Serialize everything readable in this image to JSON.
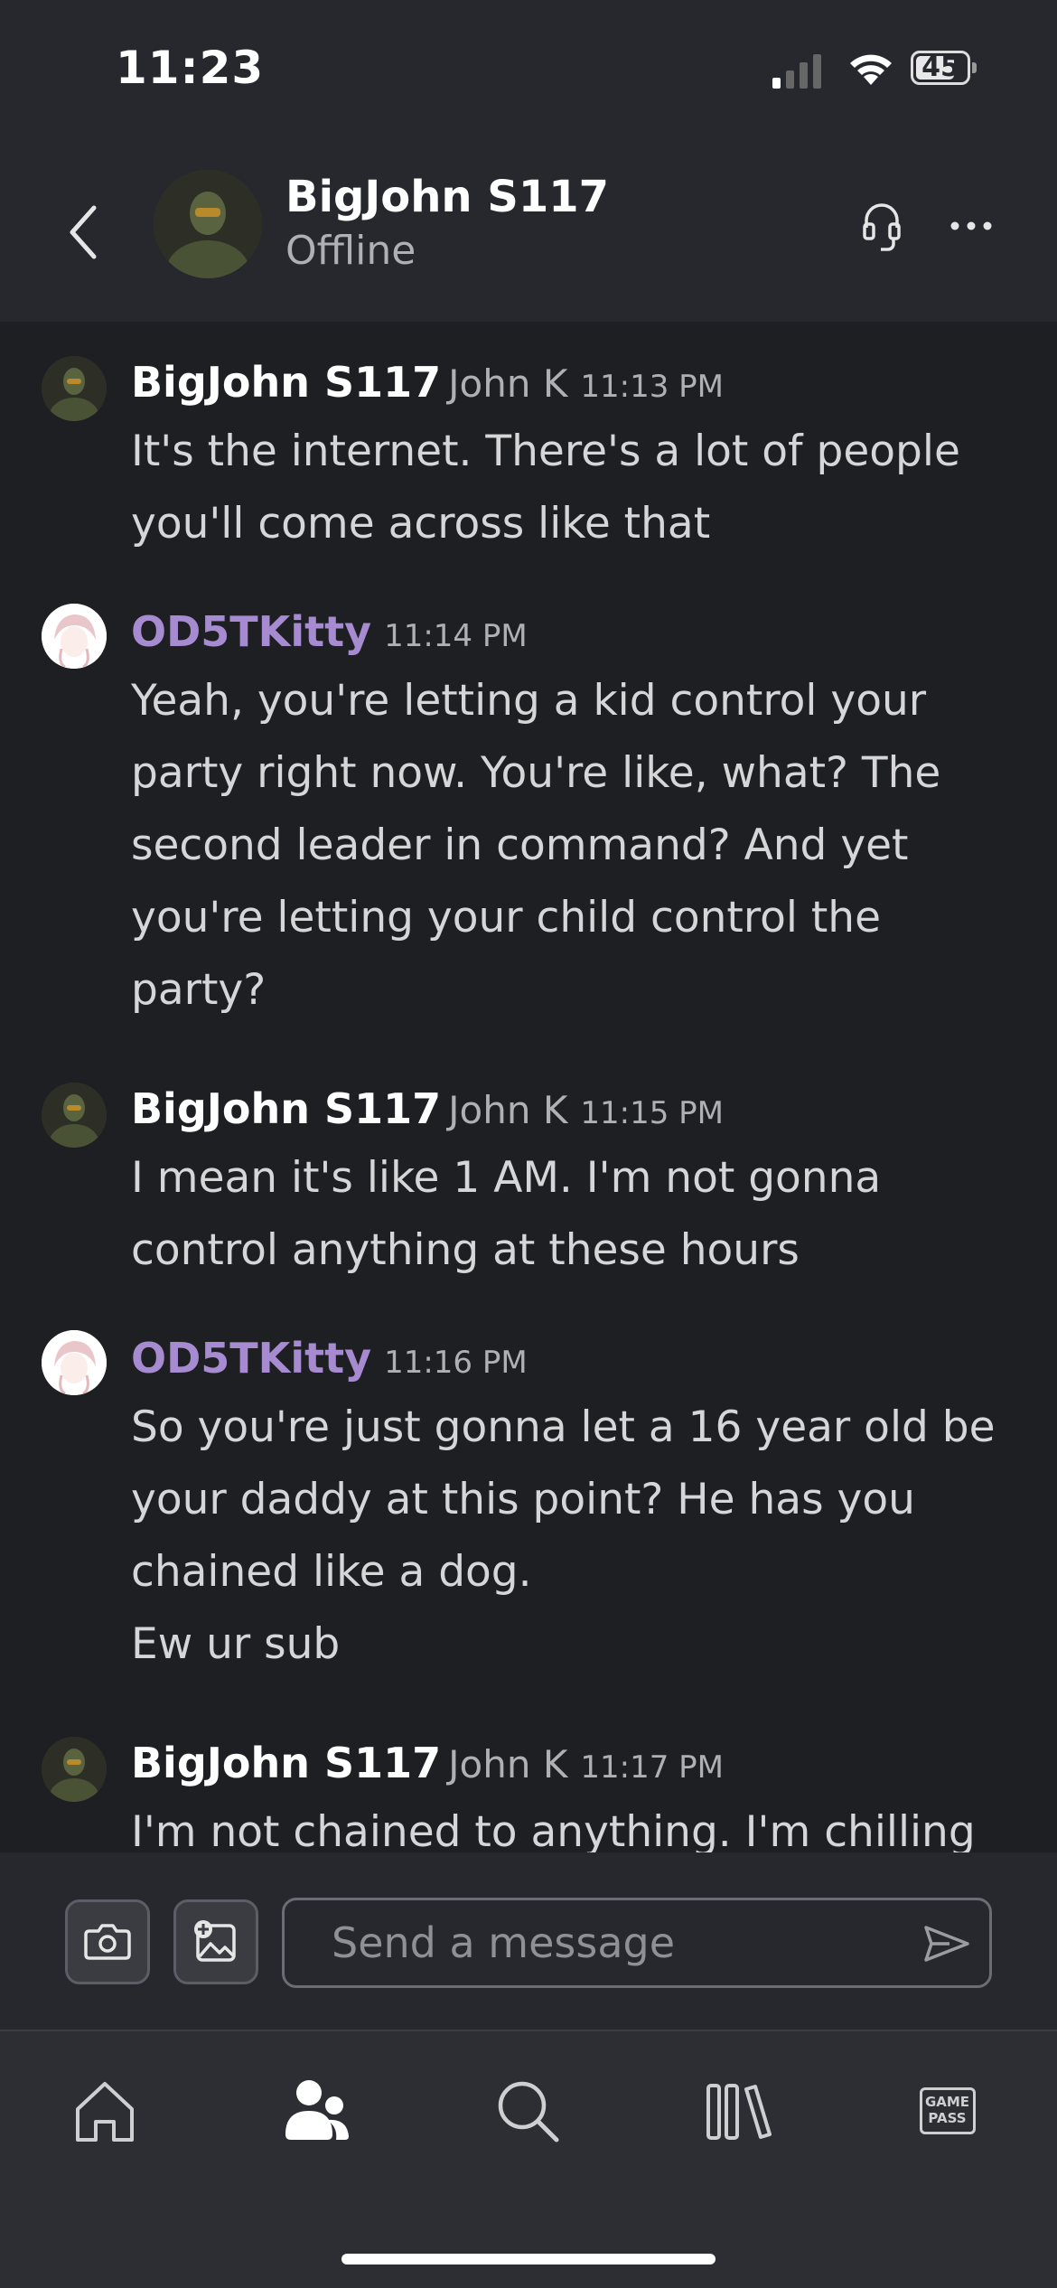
{
  "status_bar": {
    "time": "11:23",
    "battery": "45"
  },
  "header": {
    "name": "BigJohn S117",
    "status": "Offline"
  },
  "messages": [
    {
      "author": "BigJohn S117",
      "gamertag": "John K",
      "time": "11:13 PM",
      "lines": [
        "It's the internet. There's a lot of people",
        "you'll come across like that"
      ]
    },
    {
      "author": "OD5TKitty",
      "gamertag": "",
      "time": "11:14 PM",
      "lines": [
        "Yeah, you're letting a kid control your",
        "party right now. You're like, what? The",
        "second leader in command? And yet",
        "you're letting your child control the",
        "party?"
      ]
    },
    {
      "author": "BigJohn S117",
      "gamertag": "John K",
      "time": "11:15 PM",
      "lines": [
        "I mean it's like 1 AM. I'm not gonna",
        "control anything at these hours"
      ]
    },
    {
      "author": "OD5TKitty",
      "gamertag": "",
      "time": "11:16 PM",
      "lines": [
        "So you're just gonna let a 16 year old be",
        "your daddy at this point? He has you",
        "chained like a dog.",
        "Ew ur sub"
      ]
    },
    {
      "author": "BigJohn S117",
      "gamertag": "John K",
      "time": "11:17 PM",
      "lines": [
        "I'm not chained to anything. I'm chilling"
      ]
    }
  ],
  "composer": {
    "placeholder": "Send a message"
  },
  "nav": {
    "gamepass_line1": "GAME",
    "gamepass_line2": "PASS"
  },
  "colors": {
    "background": "#1e1f23",
    "header": "#26282d",
    "accent_purple": "#a78bd0"
  }
}
